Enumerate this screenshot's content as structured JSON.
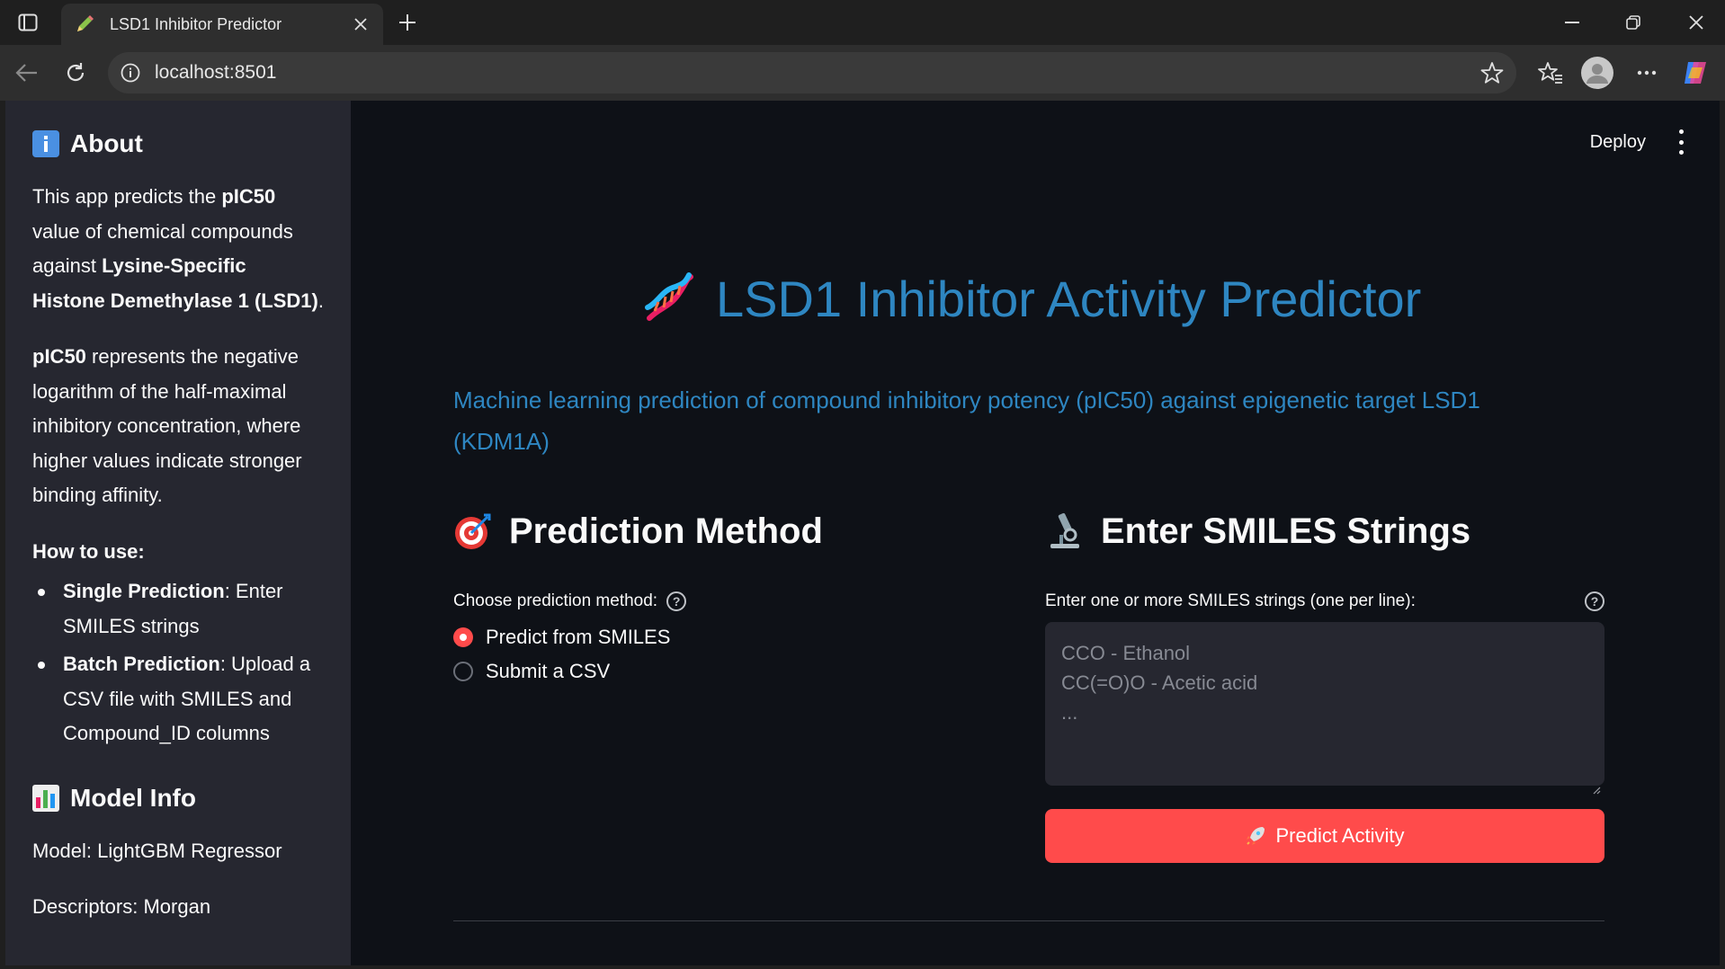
{
  "browser": {
    "tab_title": "LSD1 Inhibitor Predictor",
    "url": "localhost:8501"
  },
  "header": {
    "deploy_label": "Deploy"
  },
  "sidebar": {
    "about_heading": "About",
    "about_p1": [
      {
        "text": "This app predicts the ",
        "bold": false
      },
      {
        "text": "pIC50",
        "bold": true
      },
      {
        "text": " value of chemical compounds against ",
        "bold": false
      },
      {
        "text": "Lysine-Specific Histone Demethylase 1 (LSD1)",
        "bold": true
      },
      {
        "text": ".",
        "bold": false
      }
    ],
    "about_p2": [
      {
        "text": "pIC50",
        "bold": true
      },
      {
        "text": " represents the negative logarithm of the half-maximal inhibitory concentration, where higher values indicate stronger binding affinity.",
        "bold": false
      }
    ],
    "how_to_use": "How to use:",
    "steps": [
      {
        "bold": "Single Prediction",
        "rest": ": Enter SMILES strings"
      },
      {
        "bold": "Batch Prediction",
        "rest": ": Upload a CSV file with SMILES and Compound_ID columns"
      }
    ],
    "model_info_heading": "Model Info",
    "model": "Model: LightGBM Regressor",
    "descriptors": "Descriptors: Morgan"
  },
  "main": {
    "title": "LSD1 Inhibitor Activity Predictor",
    "subtitle": "Machine learning prediction of compound inhibitory potency (pIC50) against epigenetic target LSD1 (KDM1A)",
    "method_heading": "Prediction Method",
    "method_label": "Choose prediction method:",
    "method_options": [
      "Predict from SMILES",
      "Submit a CSV"
    ],
    "method_selected": "Predict from SMILES",
    "smiles_heading": "Enter SMILES Strings",
    "smiles_label": "Enter one or more SMILES strings (one per line):",
    "smiles_placeholder": [
      "CCO - Ethanol",
      "CC(=O)O - Acetic acid",
      "..."
    ],
    "predict_button": "Predict Activity"
  },
  "colors": {
    "accent": "#ff4b4b",
    "title_blue": "#2e86c1",
    "app_bg": "#0e1117",
    "sidebar_bg": "#262730"
  }
}
